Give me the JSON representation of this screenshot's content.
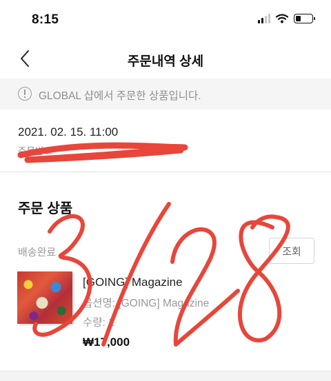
{
  "status_bar": {
    "time": "8:15"
  },
  "header": {
    "title": "주문내역 상세",
    "back_icon": "chevron-left-icon"
  },
  "notice": {
    "text": "GLOBAL 샵에서 주문한 상품입니다.",
    "icon": "info-circle-icon"
  },
  "order": {
    "date": "2021. 02. 15. 11:00",
    "number_label": "주문번호"
  },
  "section": {
    "title": "주문 상품"
  },
  "shipment": {
    "status": "배송완료",
    "track_label": "조회"
  },
  "product": {
    "name": "[GOING] Magazine",
    "option": "옵션명: [GOING] Magazine",
    "quantity": "수량: 1",
    "price": "₩17,000"
  },
  "handwriting": {
    "text": "3/28",
    "color": "#e8463a"
  }
}
